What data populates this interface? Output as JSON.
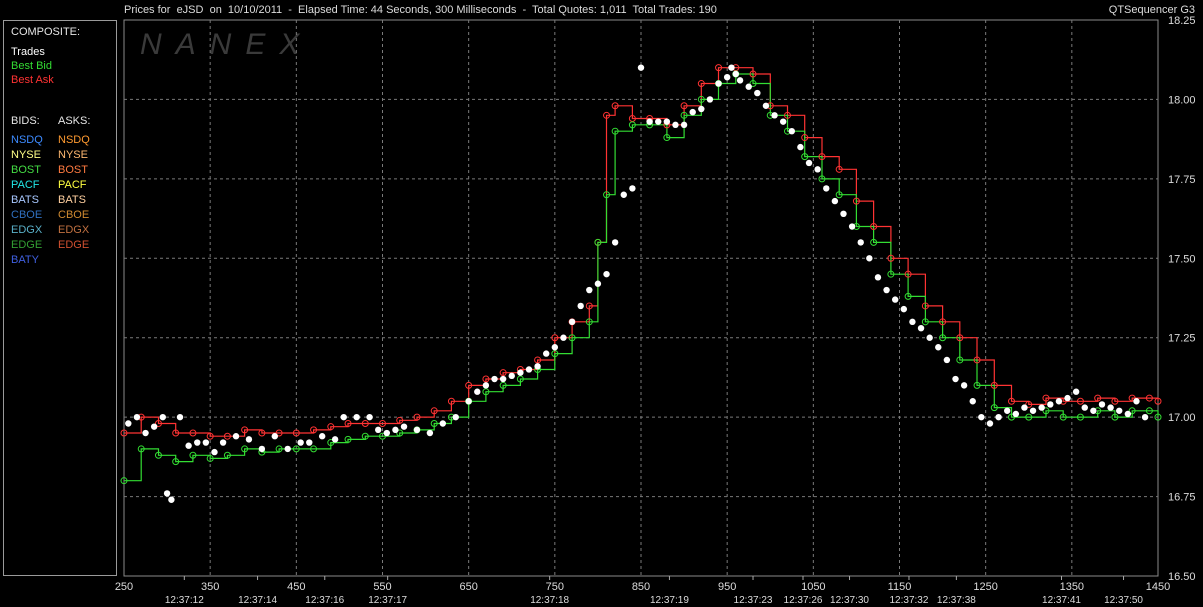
{
  "header": {
    "title": "Prices for  eJSD  on  10/10/2011  -  Elapsed Time: 44 Seconds, 300 Milliseconds  -  Total Quotes: 1,011  Total Trades: 190",
    "app_name": "QTSequencer G3"
  },
  "watermark": "NANEX",
  "legend": {
    "composite_heading": "COMPOSITE:",
    "composite": [
      {
        "label": "Trades",
        "color": "#ffffff"
      },
      {
        "label": "Best Bid",
        "color": "#33dd33"
      },
      {
        "label": "Best Ask",
        "color": "#ff3333"
      }
    ],
    "bids_heading": "BIDS:",
    "asks_heading": "ASKS:",
    "bids": [
      {
        "label": "NSDQ",
        "color": "#3d8bff"
      },
      {
        "label": "NYSE",
        "color": "#ffff88"
      },
      {
        "label": "BOST",
        "color": "#44dd44"
      },
      {
        "label": "PACF",
        "color": "#22e6e6"
      },
      {
        "label": "BATS",
        "color": "#a8c8ff"
      },
      {
        "label": "CBOE",
        "color": "#3070c0"
      },
      {
        "label": "EDGX",
        "color": "#5ab0c8"
      },
      {
        "label": "EDGE",
        "color": "#33a033"
      },
      {
        "label": "BATY",
        "color": "#4060e0"
      }
    ],
    "asks": [
      {
        "label": "NSDQ",
        "color": "#ff9a30"
      },
      {
        "label": "NYSE",
        "color": "#ffb870"
      },
      {
        "label": "BOST",
        "color": "#ff7a40"
      },
      {
        "label": "PACF",
        "color": "#ffff40"
      },
      {
        "label": "BATS",
        "color": "#ffd0a0"
      },
      {
        "label": "CBOE",
        "color": "#d08a30"
      },
      {
        "label": "EDGX",
        "color": "#c07040"
      },
      {
        "label": "EDGE",
        "color": "#d05030"
      }
    ]
  },
  "chart_data": {
    "type": "line",
    "y_ticks": [
      "18.25",
      "18.00",
      "17.75",
      "17.50",
      "17.25",
      "17.00",
      "16.75",
      "16.50"
    ],
    "ylim": [
      16.5,
      18.25
    ],
    "x_ticks": [
      "250",
      "350",
      "450",
      "550",
      "650",
      "750",
      "850",
      "950",
      "1050",
      "1150",
      "1250",
      "1350",
      "1450"
    ],
    "xlim": [
      250,
      1450
    ],
    "time_labels": [
      {
        "text": "12:37:12",
        "x": 320
      },
      {
        "text": "12:37:14",
        "x": 405
      },
      {
        "text": "12:37:16",
        "x": 483
      },
      {
        "text": "12:37:17",
        "x": 556
      },
      {
        "text": "12:37:18",
        "x": 744
      },
      {
        "text": "12:37:19",
        "x": 883
      },
      {
        "text": "12:37:23",
        "x": 980
      },
      {
        "text": "12:37:26",
        "x": 1038
      },
      {
        "text": "12:37:30",
        "x": 1092
      },
      {
        "text": "12:37:32",
        "x": 1161
      },
      {
        "text": "12:37:38",
        "x": 1216
      },
      {
        "text": "12:37:41",
        "x": 1338
      },
      {
        "text": "12:37:50",
        "x": 1410
      }
    ],
    "grid": true,
    "trades": {
      "x": [
        255,
        265,
        275,
        285,
        295,
        300,
        305,
        315,
        325,
        335,
        345,
        355,
        365,
        380,
        395,
        410,
        425,
        440,
        455,
        465,
        480,
        495,
        505,
        520,
        535,
        545,
        555,
        565,
        575,
        590,
        605,
        620,
        635,
        650,
        660,
        670,
        680,
        690,
        700,
        710,
        720,
        730,
        740,
        750,
        760,
        770,
        780,
        790,
        800,
        810,
        820,
        830,
        840,
        850,
        860,
        870,
        880,
        890,
        900,
        910,
        920,
        930,
        940,
        950,
        955,
        960,
        965,
        975,
        985,
        995,
        1005,
        1015,
        1025,
        1035,
        1045,
        1055,
        1065,
        1075,
        1085,
        1095,
        1105,
        1115,
        1125,
        1135,
        1145,
        1155,
        1165,
        1175,
        1185,
        1195,
        1205,
        1215,
        1225,
        1235,
        1245,
        1255,
        1265,
        1275,
        1285,
        1295,
        1305,
        1315,
        1325,
        1335,
        1345,
        1355,
        1365,
        1375,
        1385,
        1395,
        1405,
        1415,
        1425,
        1435
      ],
      "y": [
        16.98,
        17.0,
        16.95,
        16.97,
        17.0,
        16.76,
        16.74,
        17.0,
        16.91,
        16.92,
        16.92,
        16.89,
        16.92,
        16.94,
        16.93,
        16.9,
        16.94,
        16.9,
        16.92,
        16.92,
        16.94,
        16.93,
        17.0,
        17.0,
        17.0,
        16.96,
        16.95,
        16.96,
        16.97,
        16.96,
        16.95,
        16.98,
        17.0,
        17.05,
        17.08,
        17.1,
        17.12,
        17.12,
        17.13,
        17.14,
        17.15,
        17.16,
        17.2,
        17.22,
        17.25,
        17.3,
        17.35,
        17.4,
        17.42,
        17.45,
        17.55,
        17.7,
        17.72,
        18.1,
        17.93,
        17.93,
        17.93,
        17.92,
        17.92,
        17.96,
        17.97,
        18.0,
        18.05,
        18.07,
        18.1,
        18.08,
        18.06,
        18.04,
        18.02,
        17.98,
        17.95,
        17.93,
        17.9,
        17.85,
        17.8,
        17.78,
        17.72,
        17.68,
        17.64,
        17.6,
        17.55,
        17.5,
        17.44,
        17.4,
        17.37,
        17.34,
        17.3,
        17.28,
        17.25,
        17.22,
        17.18,
        17.12,
        17.1,
        17.05,
        17.0,
        16.98,
        17.0,
        17.02,
        17.01,
        17.03,
        17.02,
        17.03,
        17.04,
        17.05,
        17.06,
        17.08,
        17.03,
        17.02,
        17.04,
        17.03,
        17.02,
        17.01,
        17.05,
        17.0
      ]
    },
    "best_bid": {
      "x": [
        250,
        270,
        290,
        310,
        330,
        350,
        370,
        390,
        410,
        430,
        450,
        470,
        490,
        510,
        530,
        550,
        570,
        590,
        610,
        630,
        650,
        670,
        690,
        710,
        730,
        750,
        770,
        790,
        800,
        810,
        820,
        840,
        860,
        880,
        900,
        920,
        940,
        960,
        980,
        1000,
        1020,
        1040,
        1060,
        1080,
        1100,
        1120,
        1140,
        1160,
        1180,
        1200,
        1220,
        1240,
        1260,
        1280,
        1300,
        1320,
        1340,
        1360,
        1380,
        1400,
        1420,
        1440,
        1450
      ],
      "y": [
        16.8,
        16.9,
        16.88,
        16.86,
        16.88,
        16.87,
        16.88,
        16.9,
        16.89,
        16.9,
        16.9,
        16.9,
        16.92,
        16.93,
        16.94,
        16.94,
        16.95,
        16.96,
        16.98,
        17.0,
        17.05,
        17.08,
        17.1,
        17.12,
        17.15,
        17.2,
        17.25,
        17.3,
        17.55,
        17.7,
        17.9,
        17.92,
        17.92,
        17.88,
        17.95,
        18.0,
        18.05,
        18.08,
        18.05,
        17.95,
        17.9,
        17.82,
        17.75,
        17.7,
        17.6,
        17.55,
        17.45,
        17.38,
        17.3,
        17.25,
        17.18,
        17.1,
        17.03,
        17.0,
        17.0,
        17.02,
        17.0,
        17.0,
        17.02,
        17.0,
        17.02,
        17.02,
        17.0
      ]
    },
    "best_ask": {
      "x": [
        250,
        270,
        290,
        310,
        330,
        350,
        370,
        390,
        410,
        430,
        450,
        470,
        490,
        510,
        530,
        550,
        570,
        590,
        610,
        630,
        650,
        670,
        690,
        710,
        730,
        750,
        770,
        790,
        800,
        810,
        820,
        840,
        860,
        880,
        900,
        920,
        940,
        960,
        980,
        1000,
        1020,
        1040,
        1060,
        1080,
        1100,
        1120,
        1140,
        1160,
        1180,
        1200,
        1220,
        1240,
        1260,
        1280,
        1300,
        1320,
        1340,
        1360,
        1380,
        1400,
        1420,
        1440,
        1450
      ],
      "y": [
        16.95,
        17.0,
        16.98,
        16.95,
        16.95,
        16.94,
        16.94,
        16.96,
        16.95,
        16.95,
        16.95,
        16.96,
        16.97,
        16.98,
        16.98,
        16.98,
        16.99,
        17.0,
        17.02,
        17.05,
        17.1,
        17.12,
        17.14,
        17.15,
        17.18,
        17.25,
        17.3,
        17.35,
        17.55,
        17.95,
        17.98,
        17.94,
        17.94,
        17.92,
        17.98,
        18.05,
        18.1,
        18.1,
        18.08,
        17.98,
        17.95,
        17.88,
        17.82,
        17.78,
        17.68,
        17.6,
        17.5,
        17.45,
        17.35,
        17.3,
        17.25,
        17.18,
        17.1,
        17.05,
        17.04,
        17.06,
        17.05,
        17.05,
        17.06,
        17.05,
        17.06,
        17.06,
        17.05
      ]
    }
  }
}
